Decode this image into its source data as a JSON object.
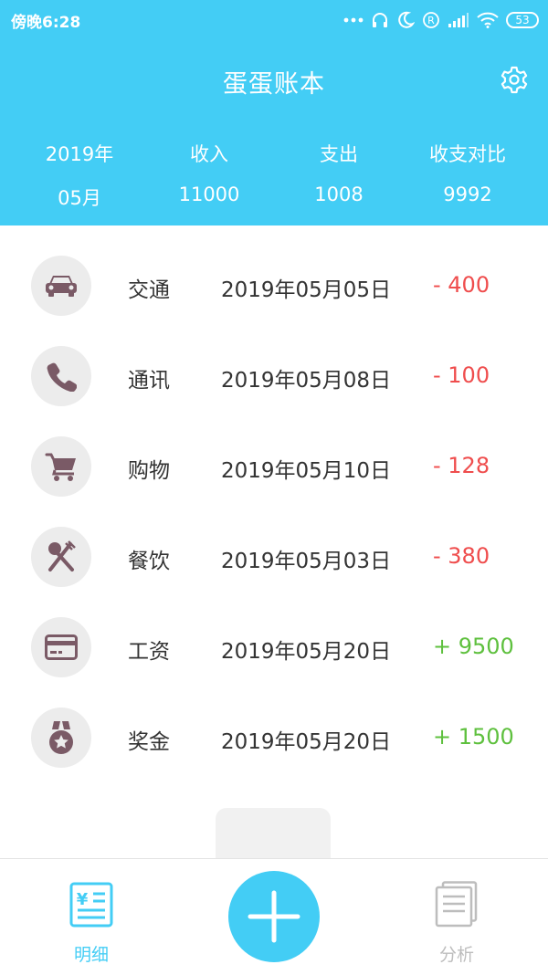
{
  "status_bar": {
    "time": "傍晚6:28",
    "battery": "53",
    "icons": [
      "more-dots-icon",
      "headset-icon",
      "moon-icon",
      "registered-icon",
      "signal-icon",
      "wifi-icon",
      "battery-icon"
    ]
  },
  "header": {
    "title": "蛋蛋账本",
    "settings_icon": "gear-icon",
    "background": "#43cdf5"
  },
  "summary": {
    "year": "2019年",
    "month": "05月",
    "income_label": "收入",
    "income_value": "11000",
    "expense_label": "支出",
    "expense_value": "1008",
    "balance_label": "收支对比",
    "balance_value": "9992"
  },
  "records": [
    {
      "icon": "car-icon",
      "category": "交通",
      "date": "2019年05月05日",
      "amount": "- 400",
      "type": "expense"
    },
    {
      "icon": "phone-icon",
      "category": "通讯",
      "date": "2019年05月08日",
      "amount": "- 100",
      "type": "expense"
    },
    {
      "icon": "cart-icon",
      "category": "购物",
      "date": "2019年05月10日",
      "amount": "- 128",
      "type": "expense"
    },
    {
      "icon": "utensils-icon",
      "category": "餐饮",
      "date": "2019年05月03日",
      "amount": "- 380",
      "type": "expense"
    },
    {
      "icon": "credit-card-icon",
      "category": "工资",
      "date": "2019年05月20日",
      "amount": "+ 9500",
      "type": "income"
    },
    {
      "icon": "medal-icon",
      "category": "奖金",
      "date": "2019年05月20日",
      "amount": "+ 1500",
      "type": "income"
    }
  ],
  "colors": {
    "expense": "#ef4d4d",
    "income": "#5ec03e",
    "active_tab": "#43cdf5",
    "inactive_tab": "#bdbdbd",
    "icon_fill": "#7a5a66"
  },
  "bottom_nav": {
    "detail_label": "明细",
    "detail_icon": "ledger-icon",
    "add_icon": "plus-icon",
    "analysis_label": "分析",
    "analysis_icon": "report-icon"
  }
}
